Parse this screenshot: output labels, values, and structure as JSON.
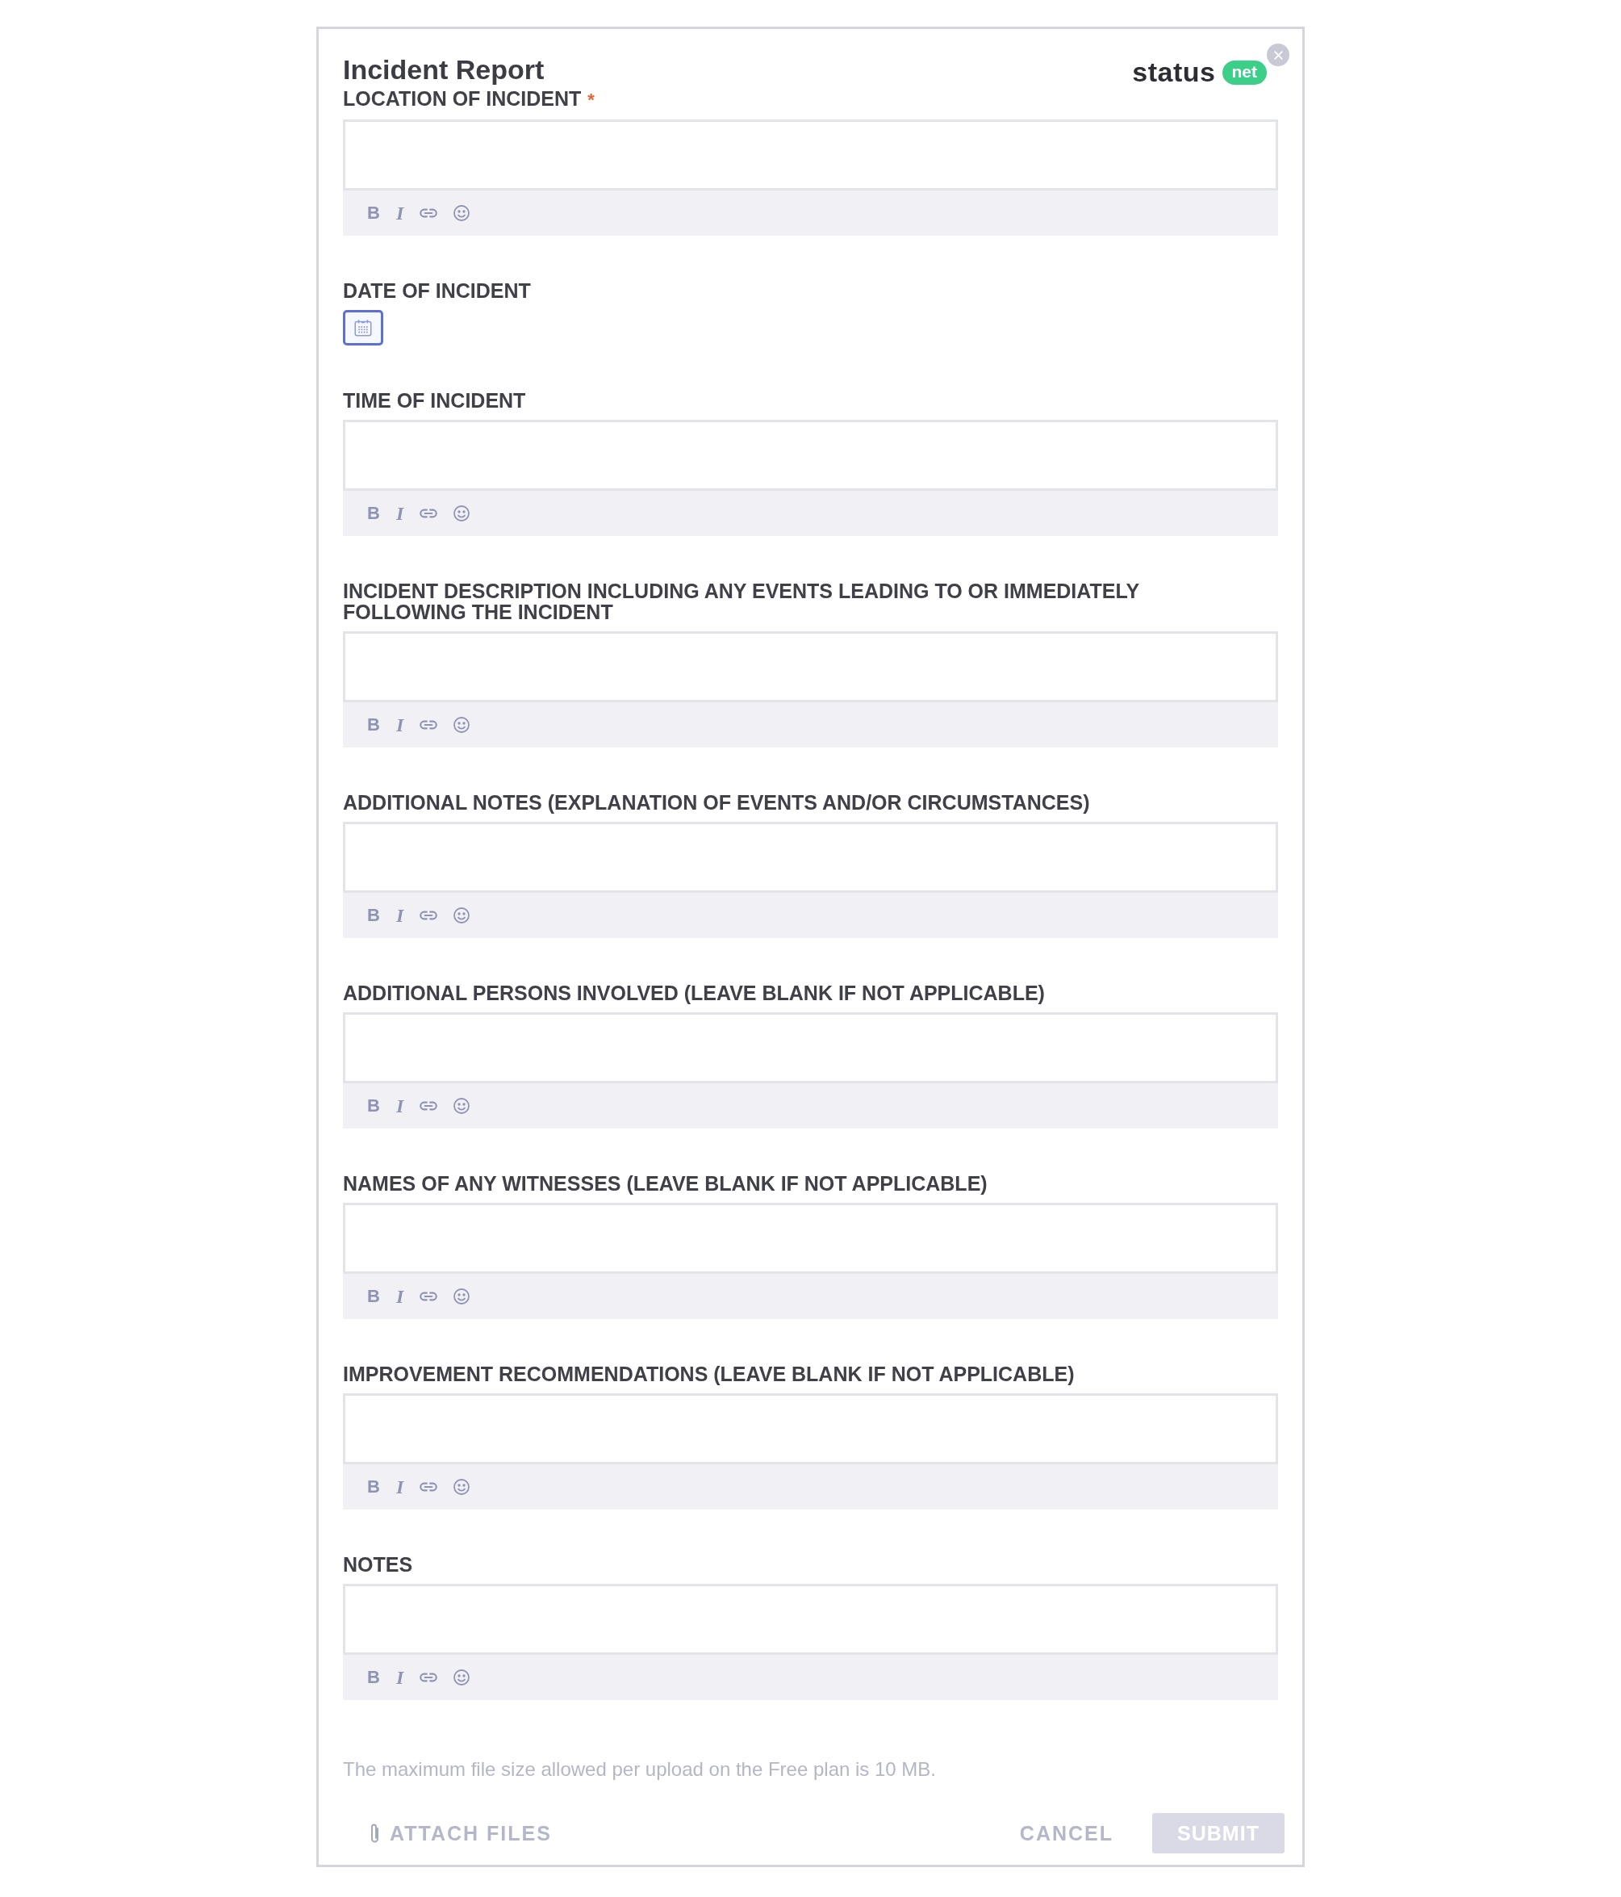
{
  "title": "Incident Report",
  "logo": {
    "word": "status",
    "badge": "net"
  },
  "fields": [
    {
      "kind": "richtext",
      "label": "LOCATION OF INCIDENT",
      "required_mark": "*",
      "toolbar": [
        "B",
        "I"
      ]
    },
    {
      "kind": "date",
      "label": "DATE OF INCIDENT"
    },
    {
      "kind": "richtext",
      "label": "TIME OF INCIDENT",
      "toolbar": [
        "B",
        "I"
      ]
    },
    {
      "kind": "richtext",
      "label": "INCIDENT DESCRIPTION INCLUDING ANY EVENTS LEADING TO OR IMMEDIATELY FOLLOWING THE INCIDENT",
      "toolbar": [
        "B",
        "I"
      ]
    },
    {
      "kind": "richtext",
      "label": "ADDITIONAL NOTES (EXPLANATION OF EVENTS AND/OR CIRCUMSTANCES)",
      "toolbar": [
        "B",
        "I"
      ]
    },
    {
      "kind": "richtext",
      "label": "ADDITIONAL PERSONS INVOLVED (LEAVE BLANK IF NOT APPLICABLE)",
      "toolbar": [
        "B",
        "I"
      ]
    },
    {
      "kind": "richtext",
      "label": "NAMES OF ANY WITNESSES (LEAVE BLANK IF NOT APPLICABLE)",
      "toolbar": [
        "B",
        "I"
      ]
    },
    {
      "kind": "richtext",
      "label": "IMPROVEMENT RECOMMENDATIONS (LEAVE BLANK IF NOT APPLICABLE)",
      "toolbar": [
        "B",
        "I"
      ]
    },
    {
      "kind": "richtext",
      "label": "NOTES",
      "toolbar": [
        "B",
        "I"
      ]
    }
  ],
  "upload_note": "The maximum file size allowed per upload on the Free plan is 10 MB.",
  "attach": "ATTACH FILES",
  "cancel": "CANCEL",
  "submit": "SUBMIT"
}
